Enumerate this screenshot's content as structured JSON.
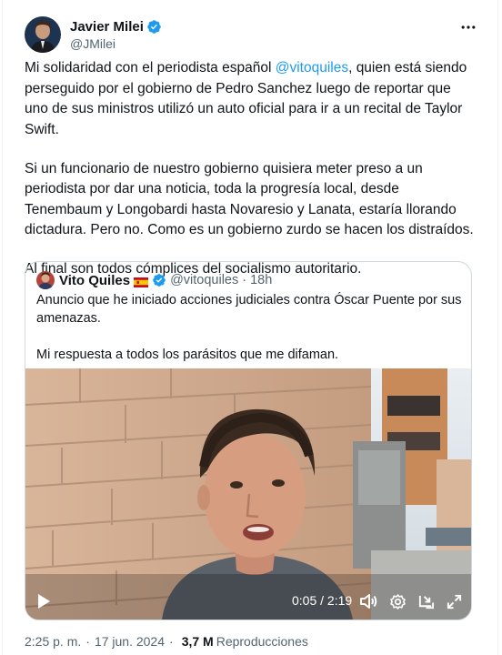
{
  "author": {
    "name": "Javier Milei",
    "handle": "@JMilei",
    "verified": true
  },
  "tweet": {
    "paragraph1": {
      "before": "Mi solidaridad con el periodista español ",
      "mention": "@vitoquiles",
      "after": ", quien está siendo perseguido por el gobierno de Pedro Sanchez luego de reportar que uno de sus ministros utilizó un auto oficial para ir a un recital de Taylor Swift."
    },
    "paragraph2": "Si un funcionario de nuestro gobierno quisiera meter preso a un periodista por dar una noticia, toda la progresía local, desde Tenembaum y Longobardi hasta Novaresio y Lanata, estaría llorando dictadura. Pero no. Como es un gobierno zurdo se hacen los distraídos.",
    "paragraph3": "Al final son todos cómplices del socialismo autoritario."
  },
  "quote": {
    "name": "Vito Quiles",
    "handle": "@vitoquiles",
    "dot": "·",
    "time": "18h",
    "text1": "Anuncio que he iniciado acciones judiciales contra Óscar Puente por sus amenazas.",
    "text2": "Mi respuesta a todos los parásitos que me difaman.",
    "video": {
      "time_display": "0:05 / 2:19",
      "progress": 0.036
    }
  },
  "footer": {
    "time": "2:25 p. m.",
    "separator": "·",
    "date": "17 jun. 2024",
    "views_count": "3,7 M",
    "views_label": "Reproducciones"
  },
  "colors": {
    "link": "#1d9bf0",
    "secondary_text": "#536471",
    "border": "#cfd9de",
    "verified": "#1d9bf0"
  },
  "icons": {
    "more": "more-icon",
    "verified": "verified-badge-icon",
    "flag": "spain-flag-icon",
    "play": "play-icon",
    "volume": "volume-icon",
    "settings": "settings-icon",
    "pip": "picture-in-picture-icon",
    "fullscreen": "fullscreen-icon"
  }
}
